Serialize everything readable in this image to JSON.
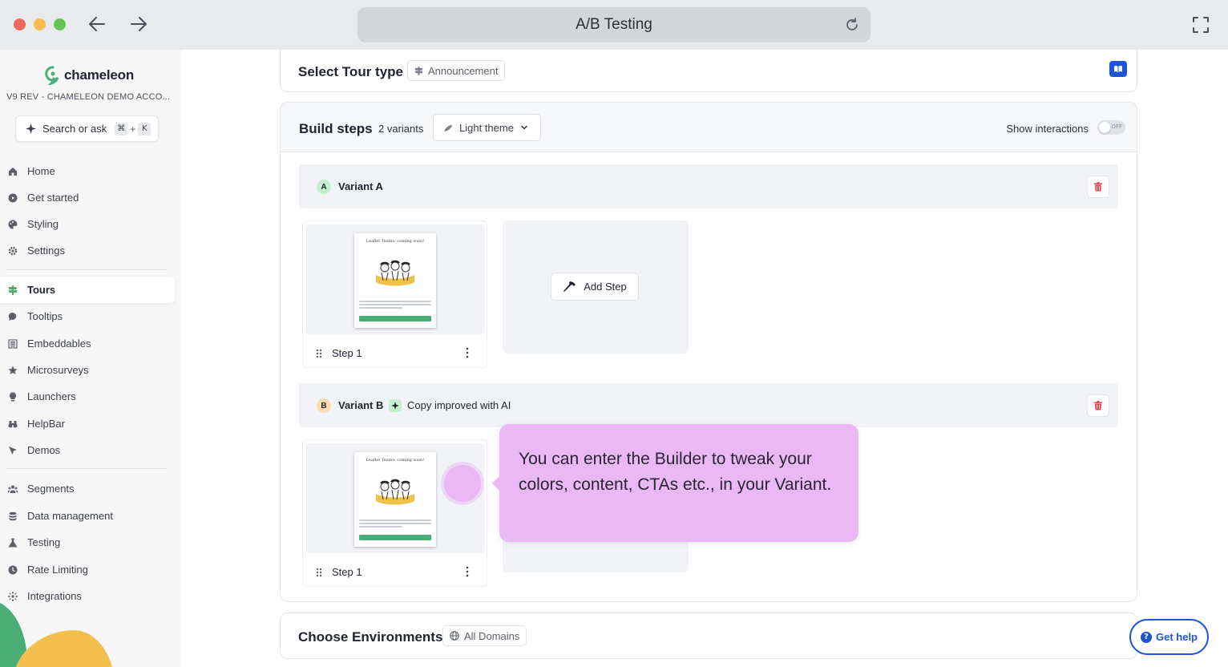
{
  "browser": {
    "title": "A/B Testing"
  },
  "sidebar": {
    "logo": "chameleon",
    "account": "V9 REV - CHAMELEON DEMO ACCO...",
    "search_label": "Search or ask",
    "search_shortcut": [
      "⌘",
      "+",
      "K"
    ],
    "items_top": [
      {
        "label": "Home",
        "icon": "home-icon"
      },
      {
        "label": "Get started",
        "icon": "play-icon"
      },
      {
        "label": "Styling",
        "icon": "palette-icon"
      },
      {
        "label": "Settings",
        "icon": "gear-icon"
      }
    ],
    "items_mid": [
      {
        "label": "Tours",
        "icon": "signpost-icon",
        "active": true
      },
      {
        "label": "Tooltips",
        "icon": "comment-icon"
      },
      {
        "label": "Embeddables",
        "icon": "embed-icon"
      },
      {
        "label": "Microsurveys",
        "icon": "star-icon"
      },
      {
        "label": "Launchers",
        "icon": "bulb-icon"
      },
      {
        "label": "HelpBar",
        "icon": "binoculars-icon"
      },
      {
        "label": "Demos",
        "icon": "pointer-icon"
      }
    ],
    "items_bottom": [
      {
        "label": "Segments",
        "icon": "users-icon"
      },
      {
        "label": "Data management",
        "icon": "database-icon"
      },
      {
        "label": "Testing",
        "icon": "flask-icon"
      },
      {
        "label": "Rate Limiting",
        "icon": "clock-icon"
      },
      {
        "label": "Integrations",
        "icon": "integrations-icon"
      }
    ]
  },
  "tour_type": {
    "title": "Select Tour type",
    "chip": "Announcement"
  },
  "build": {
    "title": "Build steps",
    "variants_count": "2 variants",
    "theme": "Light theme",
    "show_interactions": "Show interactions",
    "toggle_state": "OFF",
    "variant_a": {
      "badge": "A",
      "name": "Variant A",
      "step_label": "Step 1"
    },
    "variant_b": {
      "badge": "B",
      "name": "Variant B",
      "ai_text": "Copy improved with AI",
      "step_label": "Step 1"
    },
    "add_step": "Add Step",
    "preview_title": "Leaflet Teams: coming soon!"
  },
  "environments": {
    "title": "Choose Environments",
    "chip": "All Domains"
  },
  "help": {
    "label": "Get help"
  },
  "tooltip": {
    "text": "You can enter the Builder to tweak your colors, content, CTAs etc., in your Variant."
  },
  "colors": {
    "accent": "#1d55d6",
    "brand_green": "#4cae77",
    "tooltip_bg": "#e9b8f5",
    "danger": "#e5484d"
  }
}
